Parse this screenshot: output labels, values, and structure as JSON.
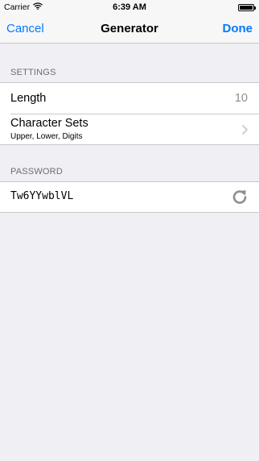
{
  "status_bar": {
    "carrier": "Carrier",
    "time": "6:39 AM",
    "icons": [
      "wifi-icon",
      "battery-icon"
    ],
    "battery_level": 1.0
  },
  "nav": {
    "cancel_label": "Cancel",
    "title": "Generator",
    "done_label": "Done"
  },
  "settings": {
    "header": "SETTINGS",
    "length": {
      "label": "Length",
      "value": "10"
    },
    "character_sets": {
      "label": "Character Sets",
      "subtitle": "Upper, Lower, Digits",
      "icon": "chevron-right-icon"
    }
  },
  "password": {
    "header": "PASSWORD",
    "value": "Tw6YYwblVL",
    "icon": "refresh-icon"
  },
  "colors": {
    "accent": "#007aff",
    "background": "#efeff4",
    "secondary_text": "#8e8e93",
    "section_header": "#6d6d72",
    "separator": "#c8c7cc"
  }
}
